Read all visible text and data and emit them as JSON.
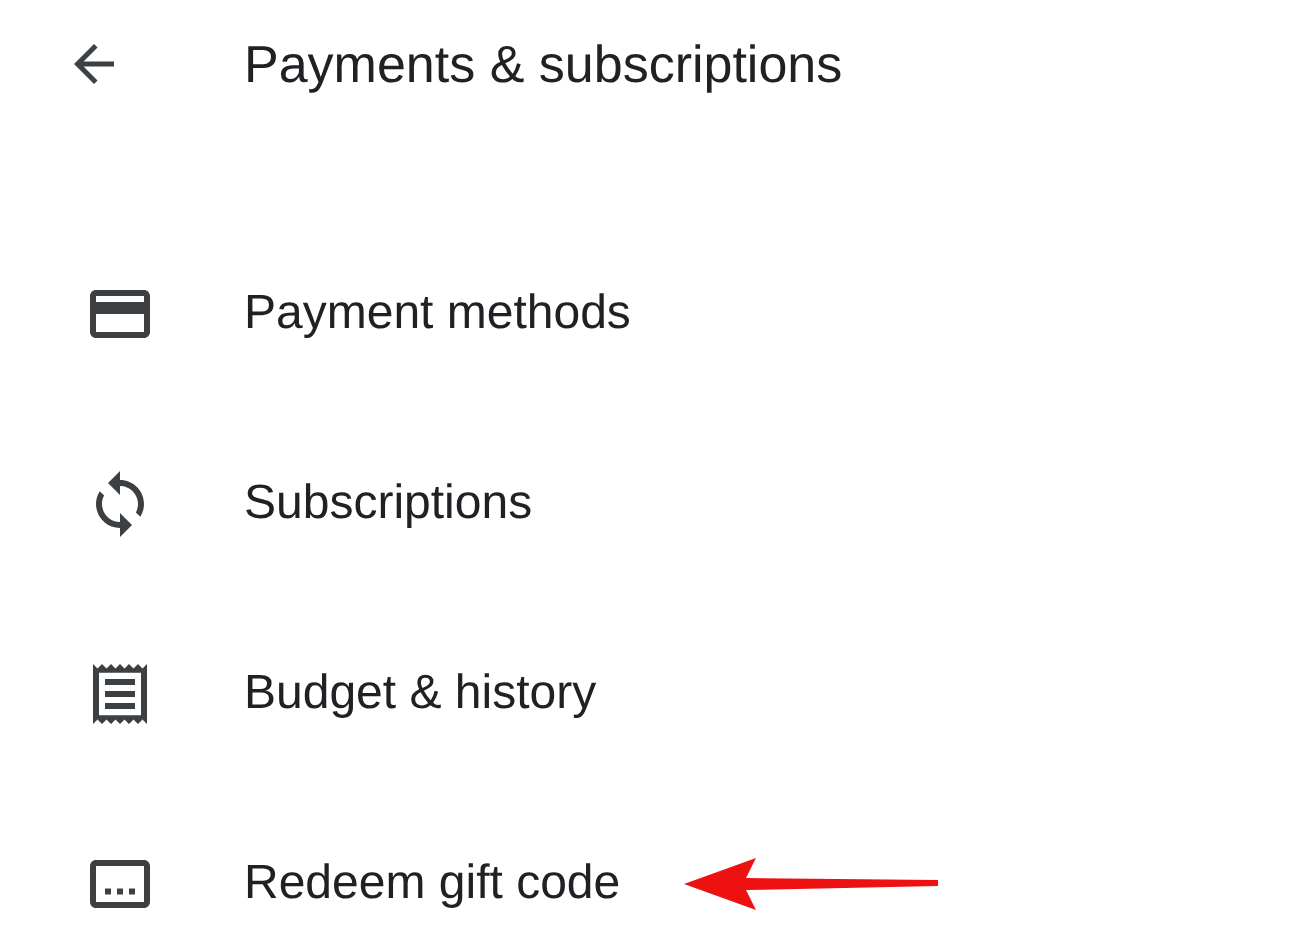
{
  "header": {
    "title": "Payments & subscriptions"
  },
  "items": [
    {
      "kind": "card",
      "label": "Payment methods",
      "pointed": false
    },
    {
      "kind": "sync",
      "label": "Subscriptions",
      "pointed": false
    },
    {
      "kind": "receipt",
      "label": "Budget & history",
      "pointed": false
    },
    {
      "kind": "code",
      "label": "Redeem gift code",
      "pointed": true
    }
  ]
}
